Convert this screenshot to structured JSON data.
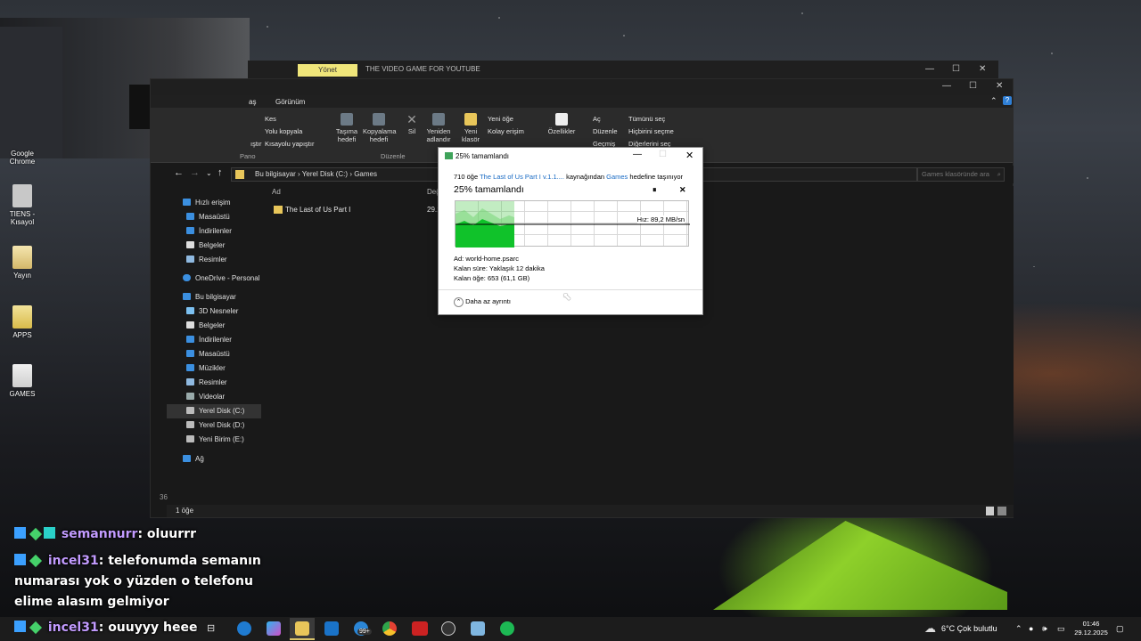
{
  "desktop": {
    "icons": [
      {
        "label": "Google Chrome",
        "name": "desktop-icon-chrome"
      },
      {
        "label": "TIENS - Kısayol",
        "name": "desktop-icon-tiens"
      },
      {
        "label": "Yayın",
        "name": "desktop-icon-yayin"
      },
      {
        "label": "APPS",
        "name": "desktop-icon-apps"
      },
      {
        "label": "GAMES",
        "name": "desktop-icon-games"
      }
    ]
  },
  "bg_window": {
    "tab": "Yönet",
    "title": "THE VIDEO GAME FOR YOUTUBE"
  },
  "explorer": {
    "menu": {
      "tab_view": "Görünüm",
      "tab_share_hint": "aş"
    },
    "ribbon": {
      "cut": "Kes",
      "copy_path": "Yolu kopyala",
      "paste_shortcut": "Kısayolu yapıştır",
      "paste_short": "ıştır",
      "move_to": "Taşıma hedefi",
      "copy_to": "Kopyalama hedefi",
      "delete": "Sil",
      "rename": "Yeniden adlandır",
      "new_folder": "Yeni klasör",
      "new_item": "Yeni öğe",
      "easy_access": "Kolay erişim",
      "properties": "Özellikler",
      "open": "Aç",
      "edit": "Düzenle",
      "history": "Geçmiş",
      "select_all": "Tümünü seç",
      "select_none": "Hiçbirini seçme",
      "invert_selection": "Diğerlerini seç",
      "group_clipboard": "Pano",
      "group_organize": "Düzenle"
    },
    "address": {
      "crumbs": [
        "Bu bilgisayar",
        "Yerel Disk (C:)",
        "Games"
      ],
      "search_placeholder": "Games klasöründe ara"
    },
    "nav": {
      "quick_access": "Hızlı erişim",
      "quick_items": [
        "Masaüstü",
        "İndirilenler",
        "Belgeler",
        "Resimler"
      ],
      "onedrive": "OneDrive - Personal",
      "this_pc": "Bu bilgisayar",
      "pc_items": [
        "3D Nesneler",
        "Belgeler",
        "İndirilenler",
        "Masaüstü",
        "Müzikler",
        "Resimler",
        "Videolar",
        "Yerel Disk (C:)",
        "Yerel Disk (D:)",
        "Yeni Birim (E:)"
      ],
      "network": "Ağ"
    },
    "columns": {
      "name": "Ad",
      "date": "Değ"
    },
    "files": [
      {
        "name": "The Last of Us Part I",
        "date": "29.1"
      }
    ],
    "status": {
      "count": "1 öğe",
      "left_stub": "36"
    }
  },
  "copy_dialog": {
    "title": "25% tamamlandı",
    "summary_count": "710 öğe",
    "summary_source": "The Last of Us Part I v.1.1....",
    "summary_mid": "kaynağından",
    "summary_dest": "Games",
    "summary_tail": "hedefine taşınıyor",
    "percent_heading": "25% tamamlandı",
    "speed": "Hız: 89,2 MB/sn",
    "progress": 0.25,
    "name_label": "Ad:",
    "name_value": "world-home.psarc",
    "time_label": "Kalan süre:",
    "time_value": "Yaklaşık 12 dakika",
    "items_label": "Kalan öğe:",
    "items_value": "653 (61,1 GB)",
    "less_details": "Daha az ayrıntı"
  },
  "chat": [
    {
      "user": "semannurr",
      "text": ": oluurrr"
    },
    {
      "user": "incel31",
      "text": ": telefonumda semanın numarası yok o yüzden o telefonu elime alasım gelmiyor"
    },
    {
      "user": "incel31",
      "text": ": ouuyyy heee"
    }
  ],
  "taskbar": {
    "weather": "6°C  Çok bulutlu",
    "time": "01:46",
    "date": "29.12.2025",
    "mail_badge": "99+",
    "accent": "#f0e67a",
    "progress_green": "#10c22a"
  }
}
